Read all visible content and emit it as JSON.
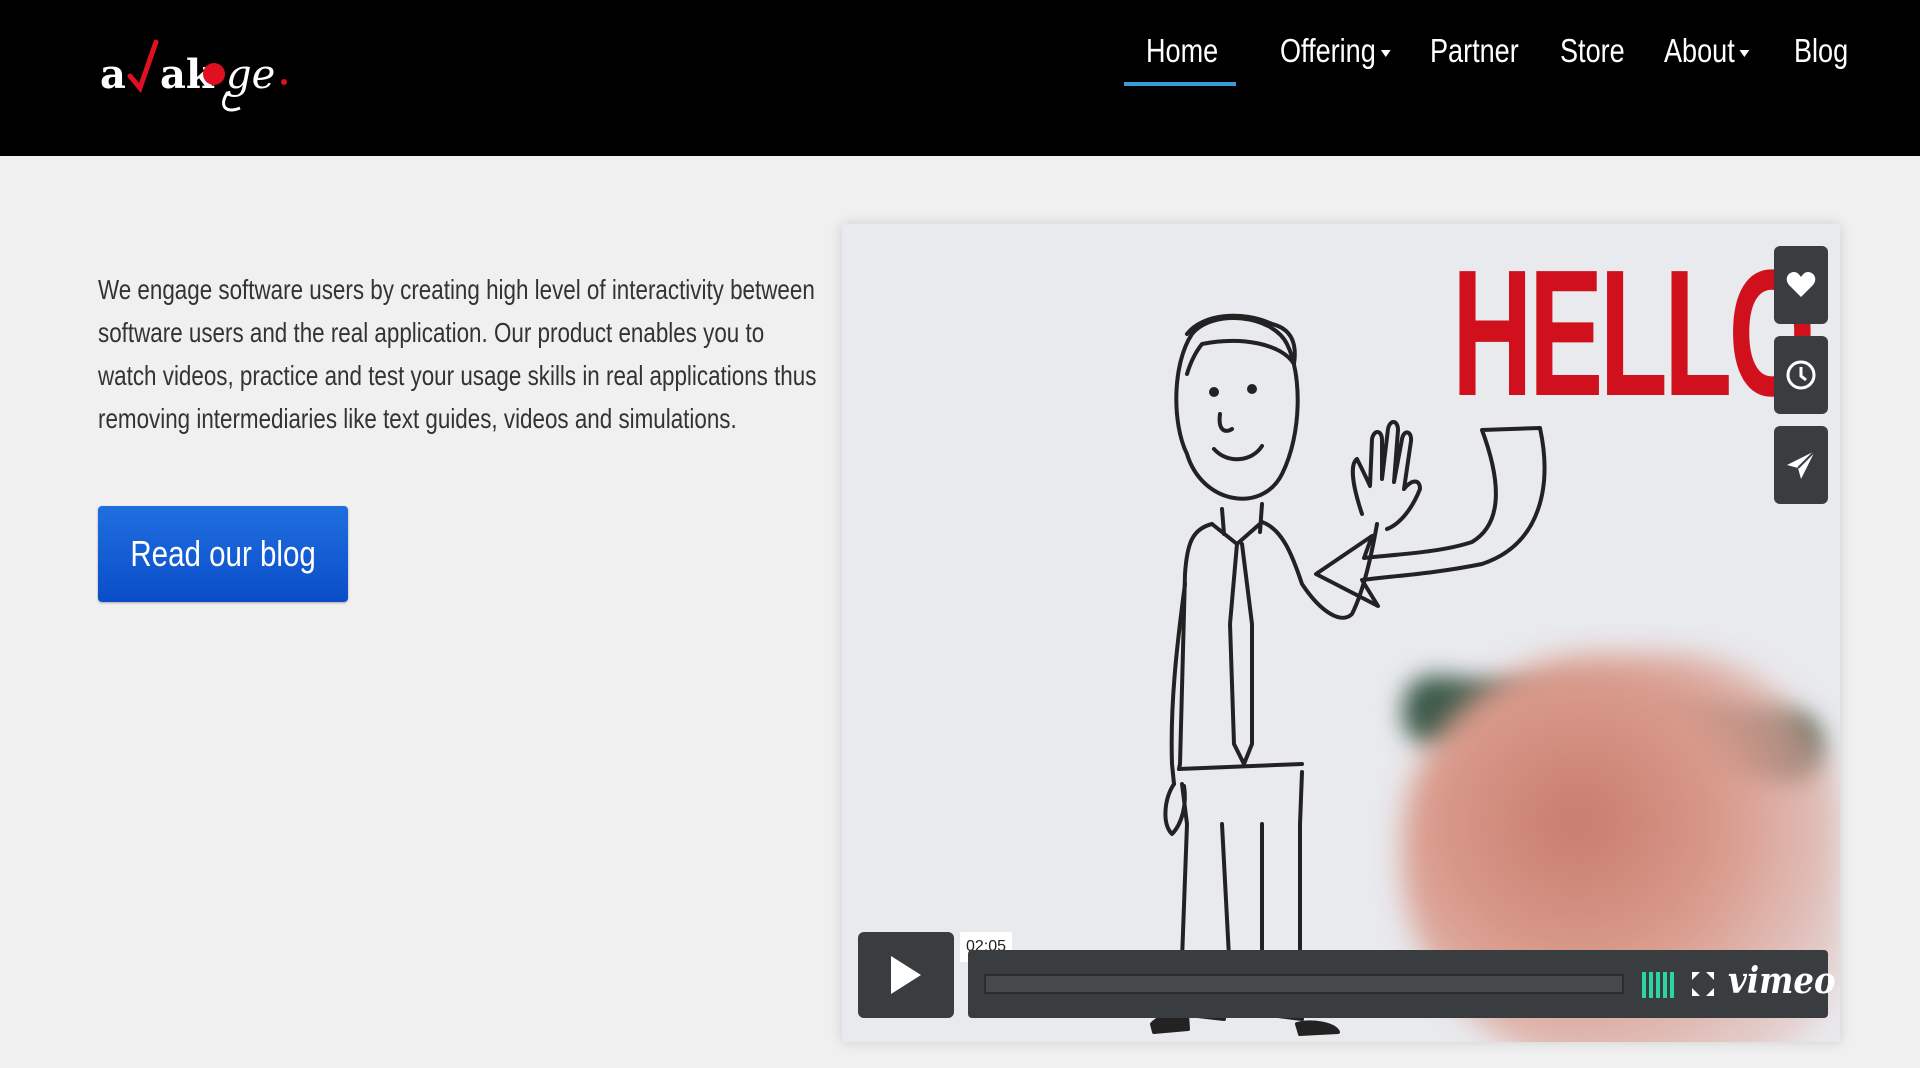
{
  "header": {
    "logo_text": "awakoge.",
    "nav": [
      {
        "label": "Home",
        "active": true,
        "has_dropdown": false
      },
      {
        "label": "Offering",
        "active": false,
        "has_dropdown": true
      },
      {
        "label": "Partner",
        "active": false,
        "has_dropdown": false
      },
      {
        "label": "Store",
        "active": false,
        "has_dropdown": false
      },
      {
        "label": "About",
        "active": false,
        "has_dropdown": true
      },
      {
        "label": "Blog",
        "active": false,
        "has_dropdown": false
      }
    ]
  },
  "main": {
    "intro_text": "We engage software users by creating high level of interactivity between software users and the real application. Our product enables you to watch videos, practice and test your usage skills in real applications thus removing intermediaries like text guides, videos and simulations.",
    "blog_button_label": "Read our blog"
  },
  "video": {
    "title_card_text": "HELLO",
    "duration": "02:05",
    "provider": "vimeo",
    "side_buttons": [
      "heart-icon",
      "clock-icon",
      "send-icon"
    ]
  },
  "colors": {
    "header_bg": "#000000",
    "accent_underline": "#3a9ad9",
    "button_blue": "#0a4dc8",
    "hello_red": "#d0101c",
    "volume_green": "#2ed3a2"
  }
}
